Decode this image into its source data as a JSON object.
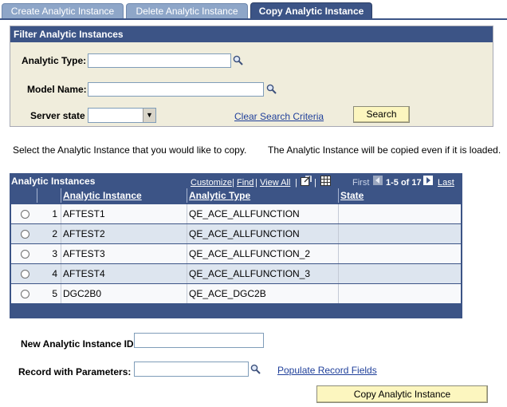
{
  "tabs": [
    {
      "label": "Create Analytic Instance"
    },
    {
      "label": "Delete Analytic Instance"
    },
    {
      "label": "Copy Analytic Instance"
    }
  ],
  "filter": {
    "title": "Filter Analytic Instances",
    "analytic_type_label": "Analytic Type:",
    "analytic_type_value": "",
    "model_name_label": "Model Name:",
    "model_name_value": "",
    "server_state_label": "Server state",
    "server_state_value": "",
    "clear_link": "Clear Search Criteria",
    "search_button": "Search"
  },
  "instructions": {
    "left": "Select the Analytic Instance that you would like to copy.",
    "right": "The Analytic Instance will be copied even if it is loaded."
  },
  "grid": {
    "title": "Analytic Instances",
    "customize": "Customize",
    "find": "Find",
    "view_all": "View All",
    "first": "First",
    "range": "1-5 of 17",
    "last": "Last",
    "columns": [
      "Analytic Instance",
      "Analytic Type",
      "State"
    ],
    "rows": [
      {
        "num": "1",
        "instance": "AFTEST1",
        "type": "QE_ACE_ALLFUNCTION",
        "state": ""
      },
      {
        "num": "2",
        "instance": "AFTEST2",
        "type": "QE_ACE_ALLFUNCTION",
        "state": ""
      },
      {
        "num": "3",
        "instance": "AFTEST3",
        "type": "QE_ACE_ALLFUNCTION_2",
        "state": ""
      },
      {
        "num": "4",
        "instance": "AFTEST4",
        "type": "QE_ACE_ALLFUNCTION_3",
        "state": ""
      },
      {
        "num": "5",
        "instance": "DGC2B0",
        "type": "QE_ACE_DGC2B",
        "state": ""
      }
    ]
  },
  "copy_form": {
    "new_id_label": "New Analytic Instance ID",
    "new_id_value": "",
    "record_label": "Record with Parameters:",
    "record_value": "",
    "populate_link": "Populate Record Fields",
    "copy_button": "Copy Analytic Instance"
  },
  "colors": {
    "header_blue": "#3c5486",
    "tab_inactive": "#8ea6c8",
    "filter_bg": "#f0eddc",
    "button_yellow": "#fcf6bf",
    "link": "#1f3f9a"
  }
}
